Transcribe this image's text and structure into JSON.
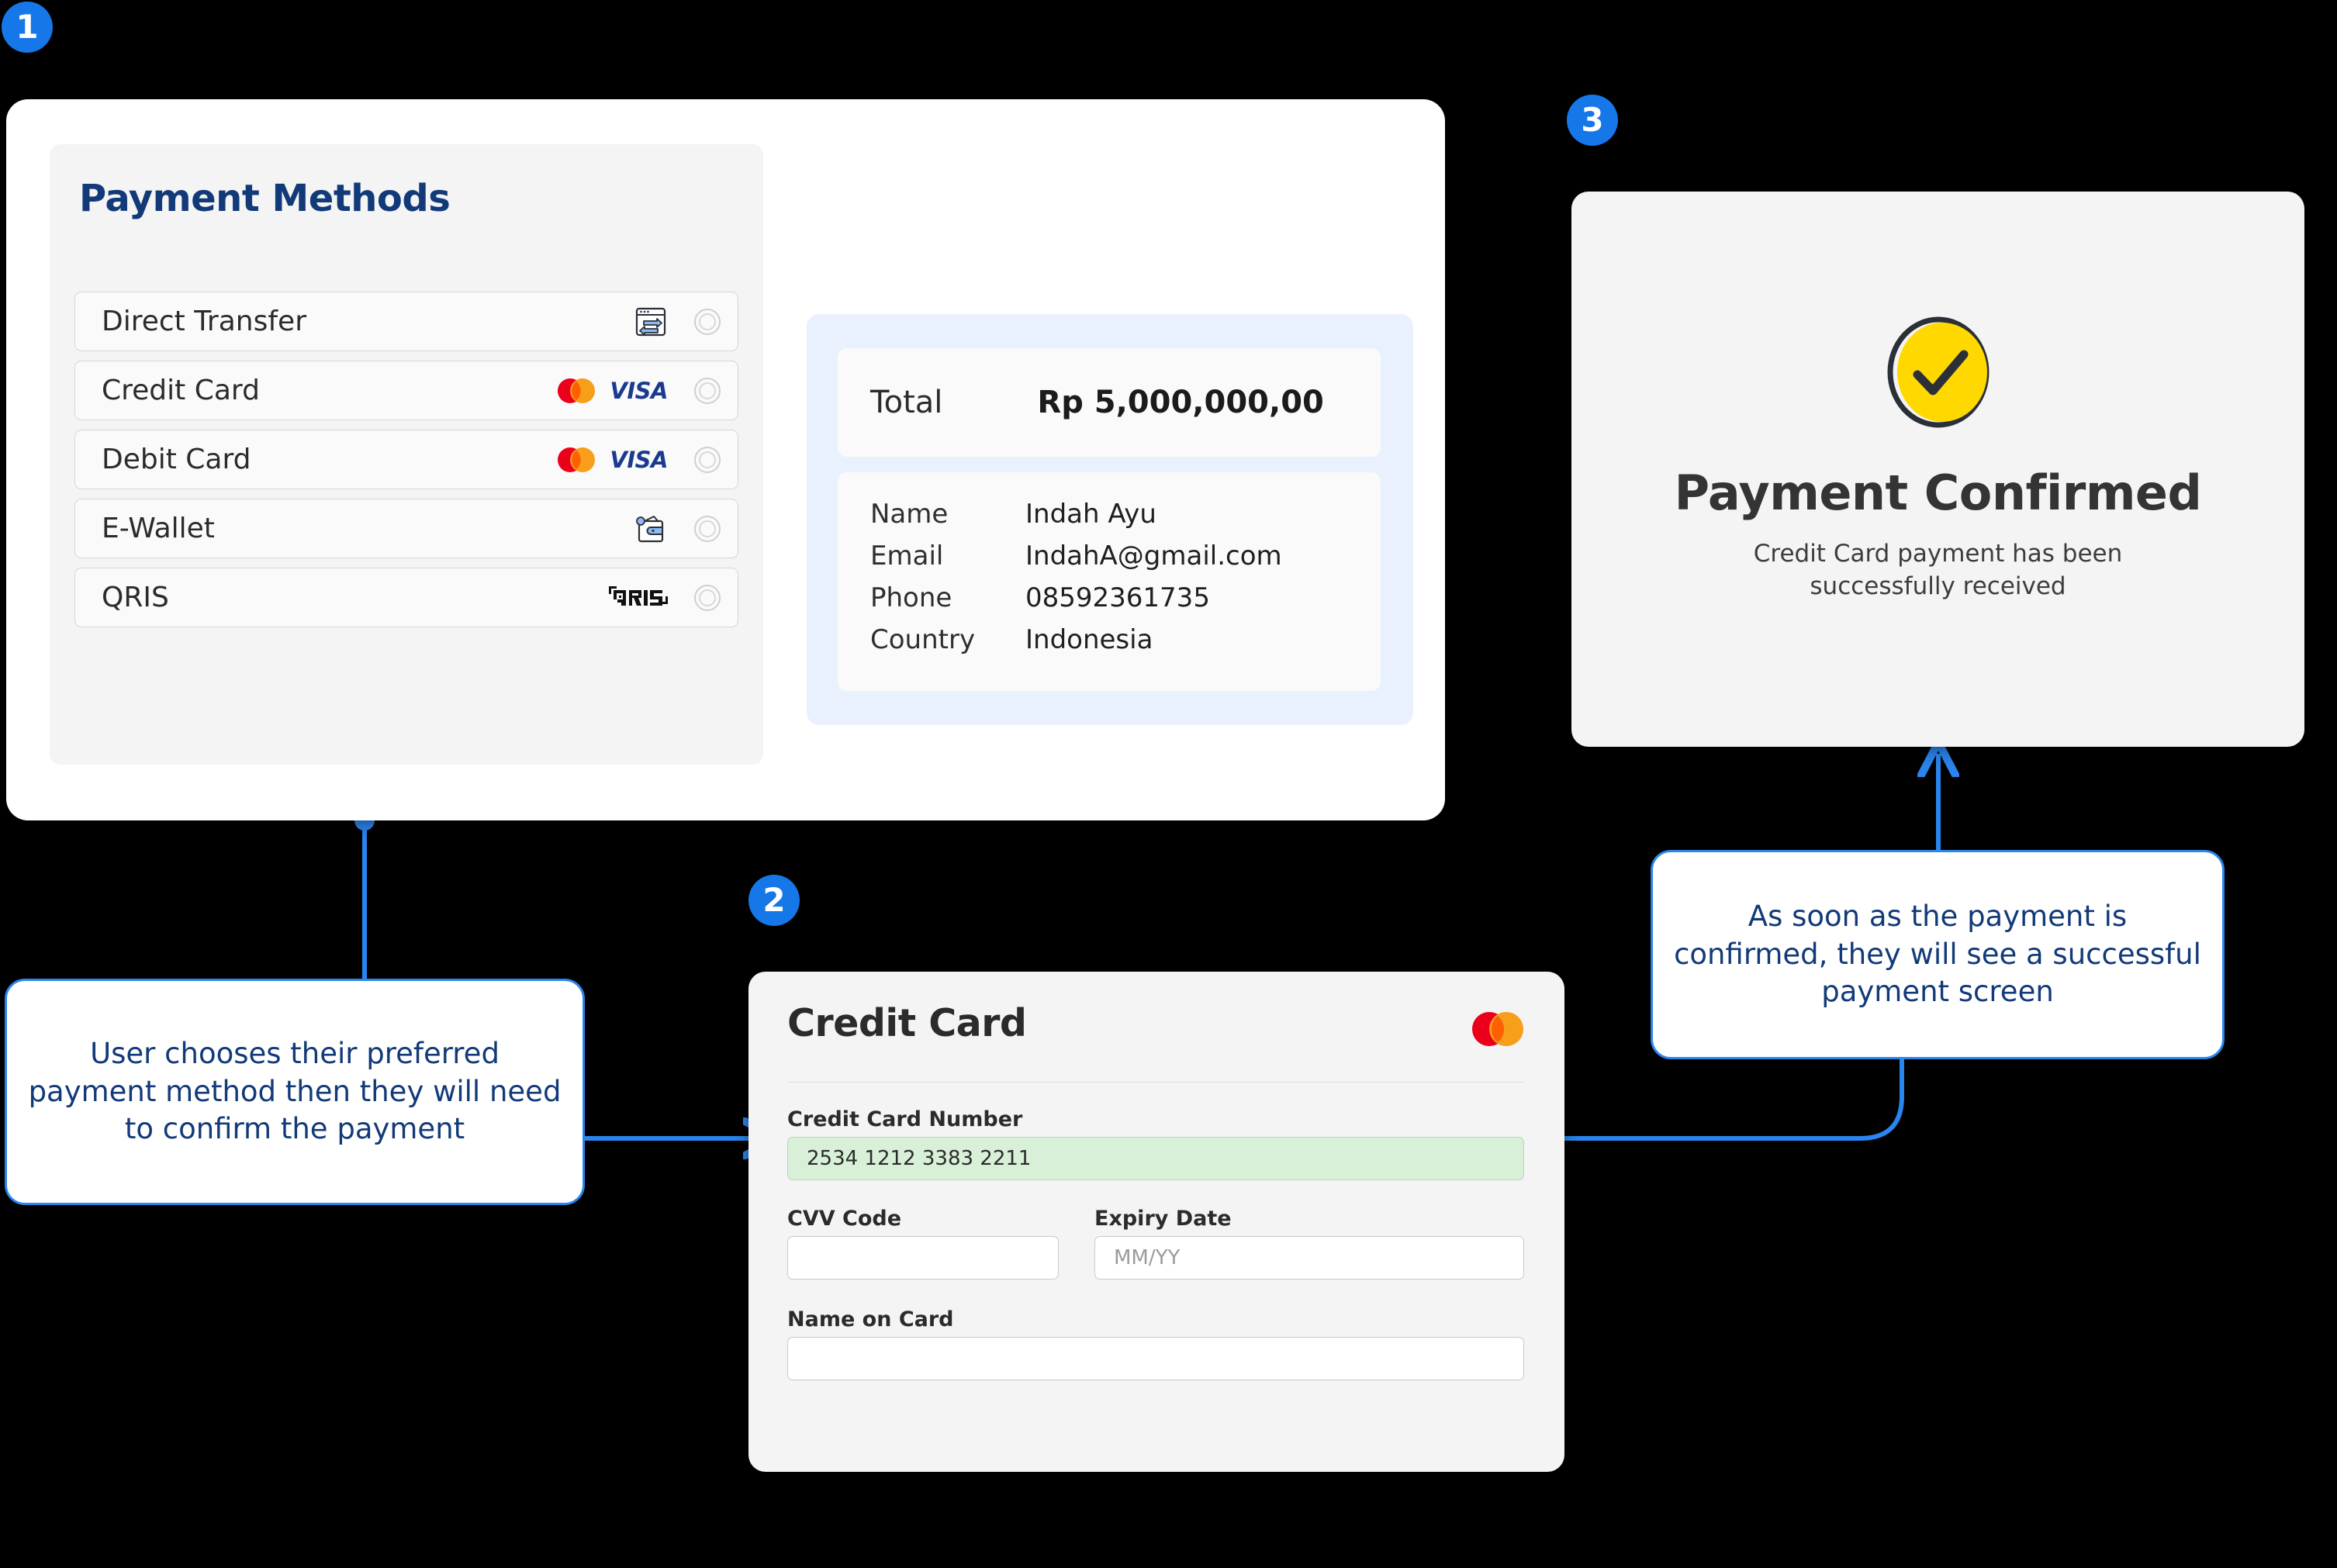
{
  "steps": [
    {
      "number": "1"
    },
    {
      "number": "2"
    },
    {
      "number": "3"
    }
  ],
  "screen1": {
    "title": "Payment Methods",
    "methods": [
      {
        "label": "Direct Transfer",
        "logos": [
          "transfer-icon"
        ]
      },
      {
        "label": "Credit Card",
        "logos": [
          "mastercard-logo",
          "visa-logo"
        ]
      },
      {
        "label": "Debit Card",
        "logos": [
          "mastercard-logo",
          "visa-logo"
        ]
      },
      {
        "label": "E-Wallet",
        "logos": [
          "wallet-icon"
        ]
      },
      {
        "label": "QRIS",
        "logos": [
          "qris-logo"
        ]
      }
    ],
    "visa_text": "VISA",
    "summary": {
      "total_label": "Total",
      "total_value": "Rp 5,000,000,00",
      "details": [
        {
          "key": "Name",
          "value": "Indah Ayu"
        },
        {
          "key": "Email",
          "value": "IndahA@gmail.com"
        },
        {
          "key": "Phone",
          "value": "08592361735"
        },
        {
          "key": "Country",
          "value": "Indonesia"
        }
      ]
    }
  },
  "screen2": {
    "title": "Credit Card",
    "fields": {
      "card_number_label": "Credit Card Number",
      "card_number_value": "2534 1212 3383 2211",
      "cvv_label": "CVV Code",
      "cvv_value": "",
      "expiry_label": "Expiry Date",
      "expiry_value": "",
      "expiry_placeholder": "MM/YY",
      "name_label": "Name on Card",
      "name_value": ""
    }
  },
  "screen3": {
    "title": "Payment Confirmed",
    "subtitle": "Credit Card payment has been successfully received"
  },
  "annotations": {
    "left": "User chooses their preferred payment method then they will need to confirm the payment",
    "right": "As soon as the payment is confirmed, they will see a successful payment screen"
  },
  "colors": {
    "accent_blue": "#2a86ef",
    "badge_blue": "#1677e8",
    "title_navy": "#123a78",
    "success_yellow": "#ffd800",
    "mastercard_red": "#eb001b",
    "mastercard_orange": "#f79e1b",
    "visa_navy": "#1a3a8f",
    "filled_field_green": "#d9f0d8"
  }
}
